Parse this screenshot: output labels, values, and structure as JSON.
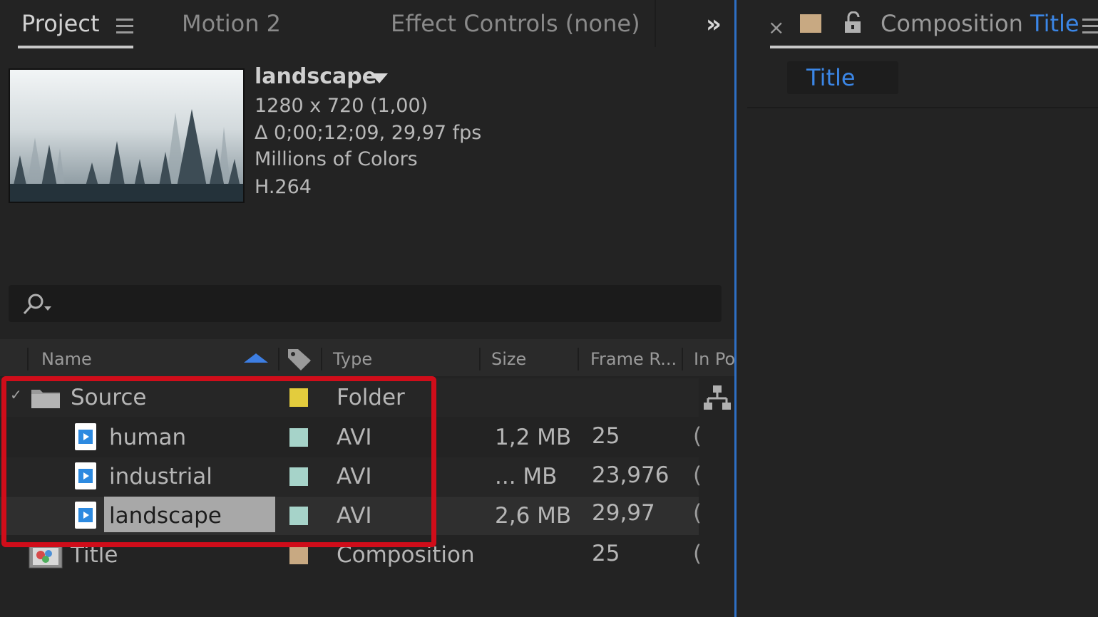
{
  "tabs": {
    "project": "Project",
    "motion": "Motion 2",
    "effect_controls": "Effect Controls (none)",
    "overflow": "»"
  },
  "preview": {
    "name": "landscape",
    "lines": [
      "1280 x 720 (1,00)",
      "Δ 0;00;12;09, 29,97 fps",
      "Millions of Colors",
      "H.264"
    ]
  },
  "search": {
    "placeholder": "",
    "icon": "search-icon"
  },
  "columns": {
    "name": "Name",
    "type": "Type",
    "size": "Size",
    "frame_rate": "Frame R...",
    "in_point": "In Po",
    "label_icon": "tag-icon"
  },
  "rows": [
    {
      "name": "Source",
      "type": "Folder",
      "size": "",
      "fps": "",
      "in": "",
      "label_color": "#e3cc3d",
      "icon": "folder-icon",
      "expanded": true
    },
    {
      "name": "human",
      "type": "AVI",
      "size": "1,2 MB",
      "fps": "25",
      "in": "(",
      "label_color": "#a6d3c9",
      "icon": "video-file-icon"
    },
    {
      "name": "industrial",
      "type": "AVI",
      "size": "... MB",
      "fps": "23,976",
      "in": "(",
      "label_color": "#a6d3c9",
      "icon": "video-file-icon"
    },
    {
      "name": "landscape",
      "type": "AVI",
      "size": "2,6 MB",
      "fps": "29,97",
      "in": "(",
      "label_color": "#a6d3c9",
      "icon": "video-file-icon",
      "selected": true
    },
    {
      "name": "Title",
      "type": "Composition",
      "size": "",
      "fps": "25",
      "in": "(",
      "label_color": "#c8a982",
      "icon": "composition-icon"
    }
  ],
  "composition_panel": {
    "close": "×",
    "title_prefix": "Composition",
    "title_name": "Title",
    "chip": "Title",
    "swatch_color": "#c8a982"
  },
  "colors": {
    "background": "#232323",
    "accent_blue": "#3b86e6",
    "highlight_red": "#d00d1a"
  }
}
